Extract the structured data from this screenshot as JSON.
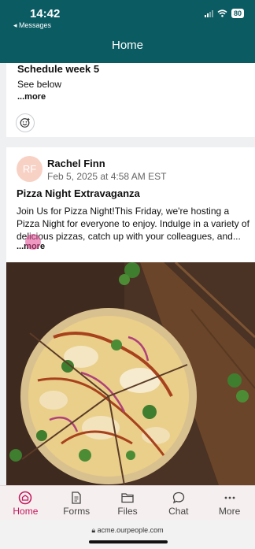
{
  "status": {
    "time": "14:42",
    "back_app": "◂ Messages",
    "battery": "80"
  },
  "header": {
    "title": "Home"
  },
  "posts": [
    {
      "title": "Schedule week 5",
      "body": "See below",
      "more_label": "...more",
      "reaction_icon": "add-reaction-icon"
    },
    {
      "avatar_initials": "RF",
      "author": "Rachel Finn",
      "date": "Feb 5, 2025 at 4:58 AM EST",
      "title": "Pizza Night Extravaganza",
      "body": "Join Us for Pizza Night!This Friday, we're hosting a Pizza Night for everyone to enjoy. Indulge in a variety of delicious pizzas, catch up with your colleagues, and...",
      "more_label": "...more",
      "image": "pizza-photo"
    }
  ],
  "tabs": [
    {
      "label": "Home",
      "icon": "home-icon",
      "active": true
    },
    {
      "label": "Forms",
      "icon": "forms-icon",
      "active": false
    },
    {
      "label": "Files",
      "icon": "folder-icon",
      "active": false
    },
    {
      "label": "Chat",
      "icon": "chat-icon",
      "active": false
    },
    {
      "label": "More",
      "icon": "more-icon",
      "active": false
    }
  ],
  "browser": {
    "url": "acme.ourpeople.com"
  },
  "colors": {
    "brand": "#0b5b63",
    "accent": "#c2185b",
    "avatar": "#f8d1c5"
  }
}
